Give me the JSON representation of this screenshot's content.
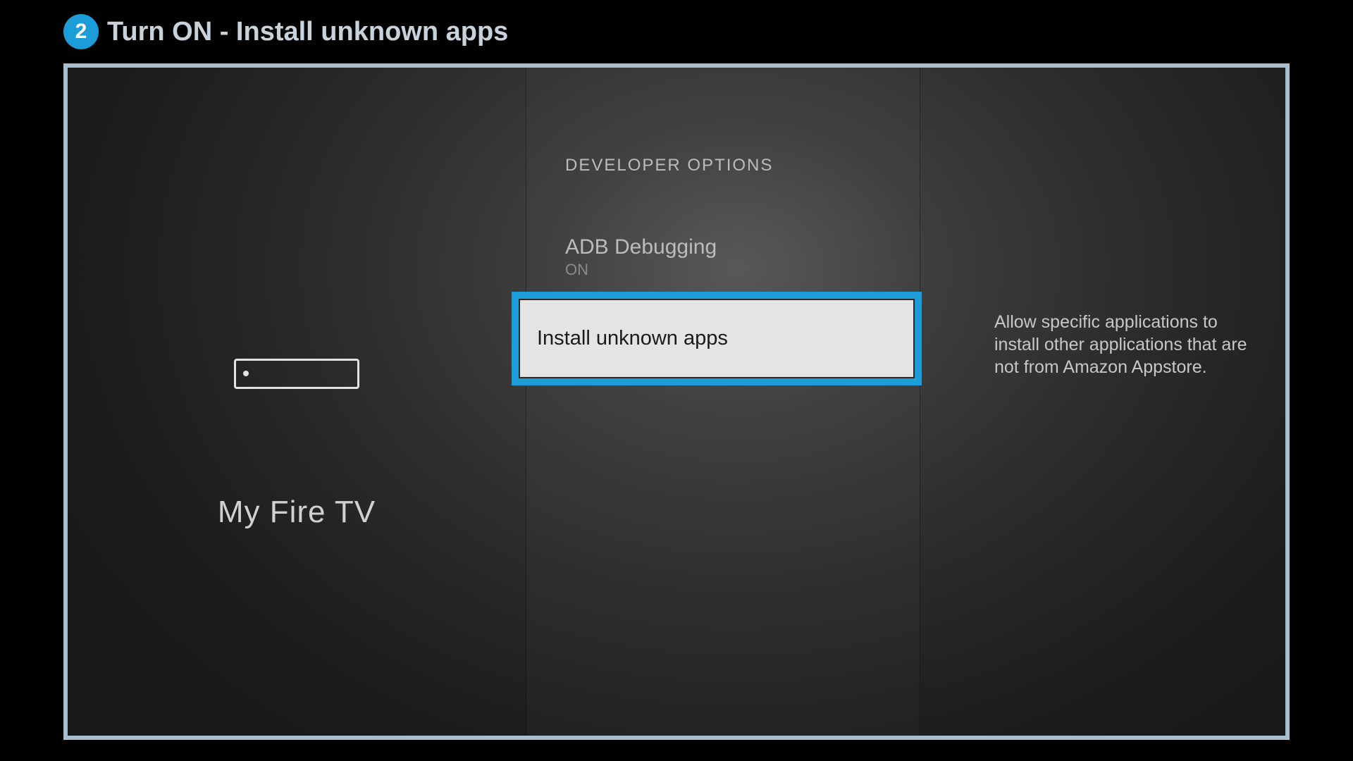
{
  "step": {
    "number": "2",
    "title": "Turn ON - Install unknown apps"
  },
  "left": {
    "device_label": "My Fire TV"
  },
  "center": {
    "section_header": "DEVELOPER OPTIONS",
    "adb": {
      "label": "ADB Debugging",
      "value": "ON"
    },
    "unknown_apps": {
      "label": "Install unknown apps"
    }
  },
  "right": {
    "description": "Allow specific applications to install other applications that are not from Amazon Appstore."
  },
  "colors": {
    "accent": "#1d9dd8"
  }
}
